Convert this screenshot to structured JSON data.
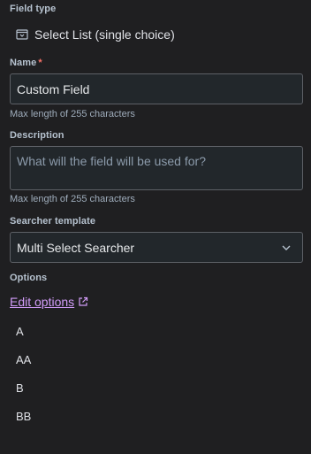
{
  "field_type": {
    "label": "Field type",
    "icon": "select-list-icon",
    "value": "Select List (single choice)"
  },
  "name": {
    "label": "Name",
    "required_mark": "*",
    "value": "Custom Field",
    "helper": "Max length of 255 characters"
  },
  "description": {
    "label": "Description",
    "placeholder": "What will the field will be used for?",
    "helper": "Max length of 255 characters"
  },
  "searcher_template": {
    "label": "Searcher template",
    "selected": "Multi Select Searcher",
    "icon": "chevron-down-icon"
  },
  "options": {
    "label": "Options",
    "edit_link": "Edit options",
    "edit_link_icon": "external-link-icon",
    "items": [
      "A",
      "AA",
      "B",
      "BB"
    ]
  },
  "colors": {
    "background": "#1f1f21",
    "input_background": "#22272b",
    "border": "#5d6066",
    "link": "#d19cf8",
    "required": "#f87168"
  }
}
